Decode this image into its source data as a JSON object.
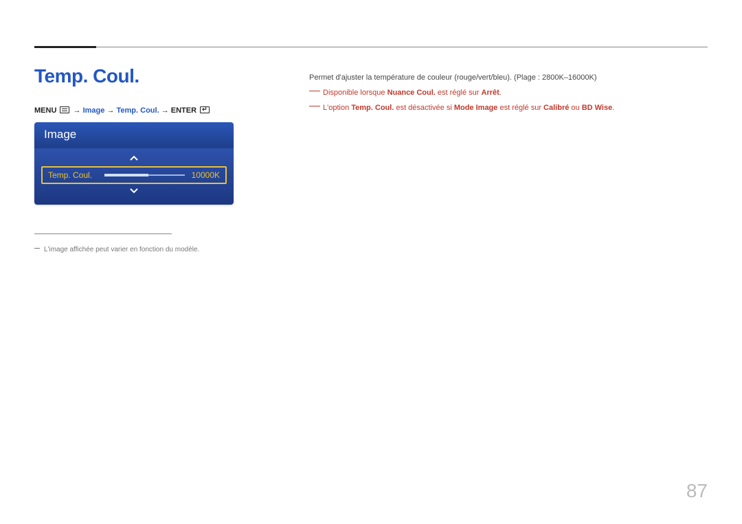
{
  "page_title": "Temp. Coul.",
  "breadcrumb": {
    "menu": "MENU",
    "arrow": "→",
    "part_image": "Image",
    "part_temp": "Temp. Coul.",
    "enter": "ENTER"
  },
  "menu_panel": {
    "header": "Image",
    "item": {
      "label": "Temp. Coul.",
      "value": "10000K",
      "slider_percent": 55
    }
  },
  "footnote": "L'image affichée peut varier en fonction du modèle.",
  "description": {
    "line1": "Permet d'ajuster la température de couleur (rouge/vert/bleu). (Plage : 2800K–16000K)",
    "note1_pre": "Disponible lorsque ",
    "note1_b1": "Nuance Coul.",
    "note1_mid": " est réglé sur ",
    "note1_b2": "Arrêt",
    "note1_end": ".",
    "note2_pre": "L'option ",
    "note2_b1": "Temp. Coul.",
    "note2_mid1": " est désactivée si ",
    "note2_b2": "Mode Image",
    "note2_mid2": " est réglé sur ",
    "note2_b3": "Calibré",
    "note2_mid3": " ou ",
    "note2_b4": "BD Wise",
    "note2_end": "."
  },
  "page_number": "87"
}
